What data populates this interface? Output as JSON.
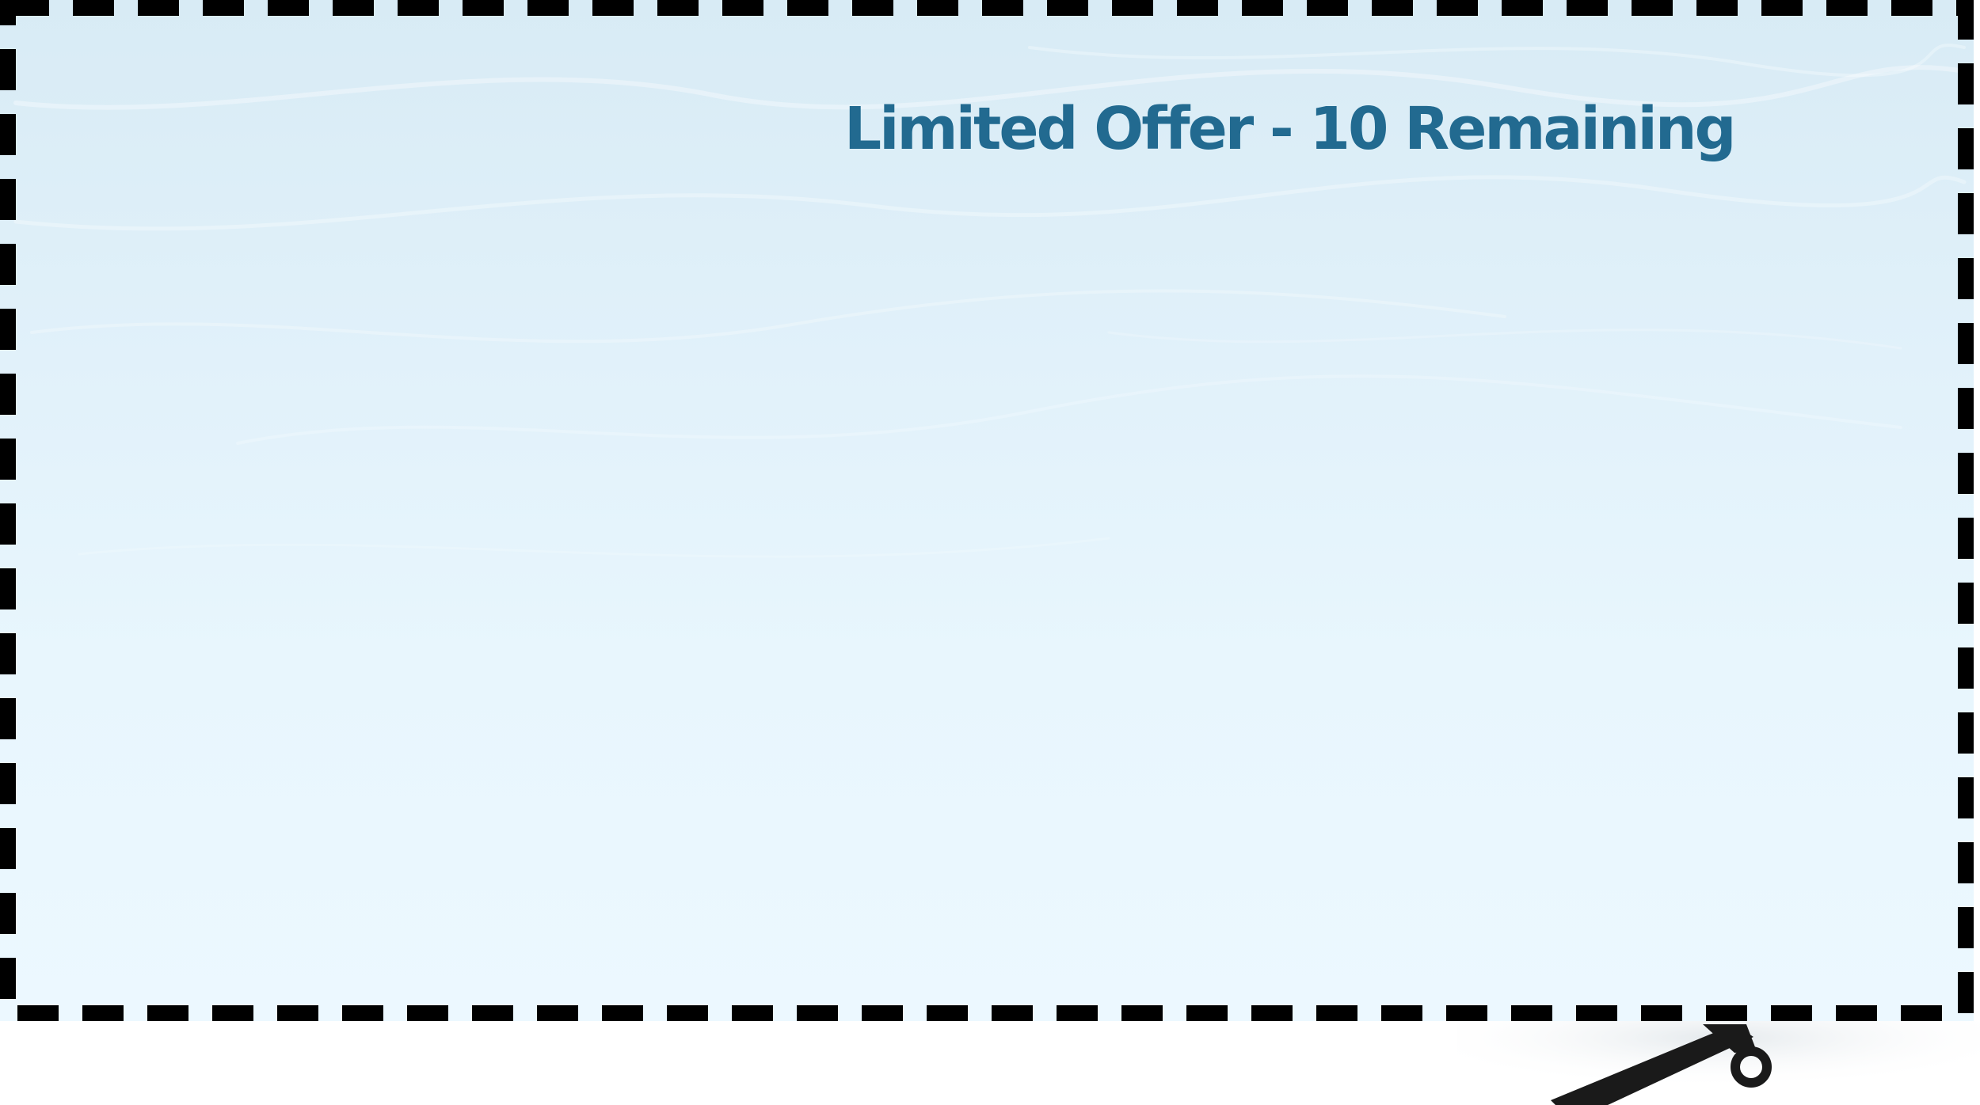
{
  "coupon": {
    "title": "Limited Offer - 10 Remaining"
  },
  "icons": {
    "scissors": "scissors-icon"
  },
  "colors": {
    "title": "#226a90",
    "border": "#000000",
    "background_top": "#d8ebf5",
    "background_bottom": "#ecf8ff"
  }
}
